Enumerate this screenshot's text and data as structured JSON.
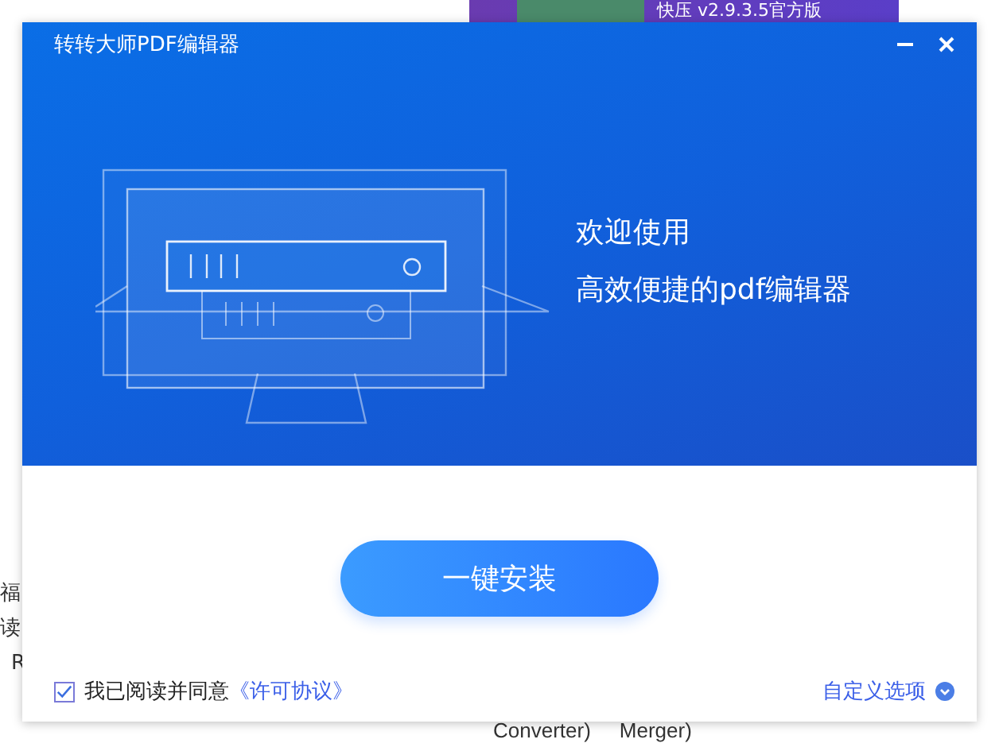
{
  "background": {
    "banner": "快压 v2.9.3.5官方版",
    "side_texts": [
      "福",
      "读",
      "R"
    ],
    "bottom_texts": [
      "Converter)",
      "Merger)"
    ]
  },
  "window": {
    "title": "转转大师PDF编辑器",
    "welcome": [
      "欢迎使用",
      "高效便捷的pdf编辑器"
    ],
    "install_button": "一键安装",
    "agreement": {
      "checked": true,
      "text": "我已阅读并同意",
      "link": "《许可协议》"
    },
    "custom_options": "自定义选项"
  }
}
